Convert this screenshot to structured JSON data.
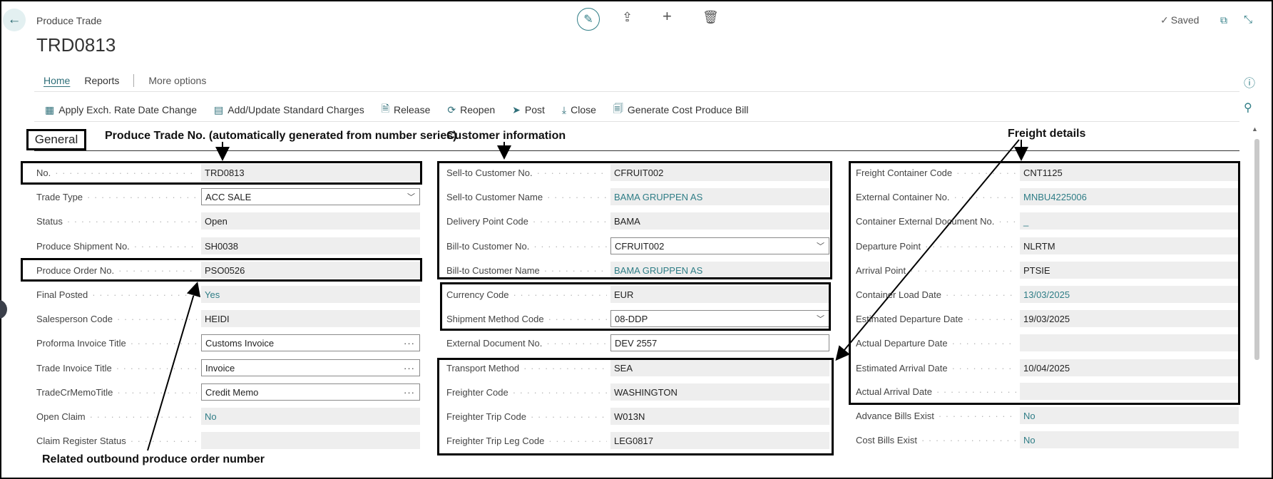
{
  "header": {
    "page_type": "Produce Trade",
    "title": "TRD0813",
    "saved_label": "Saved"
  },
  "tabs": [
    {
      "label": "Home"
    },
    {
      "label": "Reports"
    },
    {
      "label": "More options"
    }
  ],
  "actions": [
    {
      "label": "Apply Exch. Rate Date Change",
      "icon": "exchange-rate-icon"
    },
    {
      "label": "Add/Update Standard Charges",
      "icon": "charges-icon"
    },
    {
      "label": "Release",
      "icon": "release-icon"
    },
    {
      "label": "Reopen",
      "icon": "reopen-icon"
    },
    {
      "label": "Post",
      "icon": "post-icon"
    },
    {
      "label": "Close",
      "icon": "close-download-icon"
    },
    {
      "label": "Generate Cost Produce Bill",
      "icon": "bill-icon"
    }
  ],
  "section": {
    "title": "General"
  },
  "annotations": {
    "trade_no": "Produce Trade No. (automatically generated from number series)",
    "customer": "Customer information",
    "freight": "Freight details",
    "order": "Related outbound produce order number"
  },
  "col1": [
    {
      "label": "No.",
      "value": "TRD0813"
    },
    {
      "label": "Trade Type",
      "value": "ACC SALE"
    },
    {
      "label": "Status",
      "value": "Open"
    },
    {
      "label": "Produce Shipment No.",
      "value": "SH0038"
    },
    {
      "label": "Produce Order No.",
      "value": "PSO0526"
    },
    {
      "label": "Final Posted",
      "value": "Yes"
    },
    {
      "label": "Salesperson Code",
      "value": "HEIDI"
    },
    {
      "label": "Proforma Invoice Title",
      "value": "Customs Invoice"
    },
    {
      "label": "Trade Invoice Title",
      "value": "Invoice"
    },
    {
      "label": "TradeCrMemoTitle",
      "value": "Credit Memo"
    },
    {
      "label": "Open Claim",
      "value": "No"
    },
    {
      "label": "Claim Register Status",
      "value": ""
    }
  ],
  "col2": [
    {
      "label": "Sell-to Customer No.",
      "value": "CFRUIT002"
    },
    {
      "label": "Sell-to Customer Name",
      "value": "BAMA GRUPPEN AS"
    },
    {
      "label": "Delivery Point Code",
      "value": "BAMA"
    },
    {
      "label": "Bill-to Customer No.",
      "value": "CFRUIT002"
    },
    {
      "label": "Bill-to Customer Name",
      "value": "BAMA GRUPPEN AS"
    },
    {
      "label": "Currency Code",
      "value": "EUR"
    },
    {
      "label": "Shipment Method Code",
      "value": "08-DDP"
    },
    {
      "label": "External Document No.",
      "value": "DEV 2557"
    },
    {
      "label": "Transport Method",
      "value": "SEA"
    },
    {
      "label": "Freighter Code",
      "value": "WASHINGTON"
    },
    {
      "label": "Freighter Trip Code",
      "value": "W013N"
    },
    {
      "label": "Freighter Trip Leg Code",
      "value": "LEG0817"
    }
  ],
  "col3": [
    {
      "label": "Freight Container Code",
      "value": "CNT1125"
    },
    {
      "label": "External Container No.",
      "value": "MNBU4225006"
    },
    {
      "label": "Container External Document No.",
      "value": "_"
    },
    {
      "label": "Departure Point",
      "value": "NLRTM"
    },
    {
      "label": "Arrival Point",
      "value": "PTSIE"
    },
    {
      "label": "Container Load Date",
      "value": "13/03/2025"
    },
    {
      "label": "Estimated Departure Date",
      "value": "19/03/2025"
    },
    {
      "label": "Actual Departure Date",
      "value": ""
    },
    {
      "label": "Estimated Arrival Date",
      "value": "10/04/2025"
    },
    {
      "label": "Actual Arrival Date",
      "value": ""
    },
    {
      "label": "Advance Bills Exist",
      "value": "No"
    },
    {
      "label": "Cost Bills Exist",
      "value": "No"
    }
  ]
}
